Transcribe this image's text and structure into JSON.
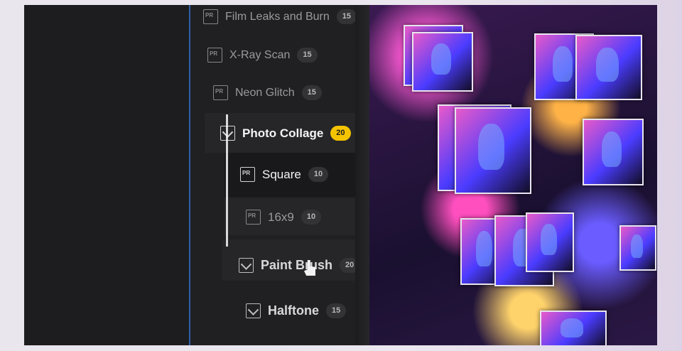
{
  "list": {
    "items": [
      {
        "label": "Film Leaks and Burn",
        "count": "15",
        "kind": "preset"
      },
      {
        "label": "X-Ray Scan",
        "count": "15",
        "kind": "preset"
      },
      {
        "label": "Neon Glitch",
        "count": "15",
        "kind": "preset"
      },
      {
        "label": "Photo Collage",
        "count": "20",
        "kind": "folder",
        "expanded": true
      },
      {
        "label": "Square",
        "count": "10",
        "kind": "preset",
        "selected": true
      },
      {
        "label": "16x9",
        "count": "10",
        "kind": "preset"
      },
      {
        "label": "Paint Brush",
        "count": "20",
        "kind": "folder"
      },
      {
        "label": "Halftone",
        "count": "15",
        "kind": "folder"
      }
    ]
  },
  "icons": {
    "preset": "premiere-preset-icon",
    "folder": "folder-expand-icon"
  },
  "colors": {
    "accent": "#f5c400",
    "selection_line": "#2f5fa8"
  }
}
